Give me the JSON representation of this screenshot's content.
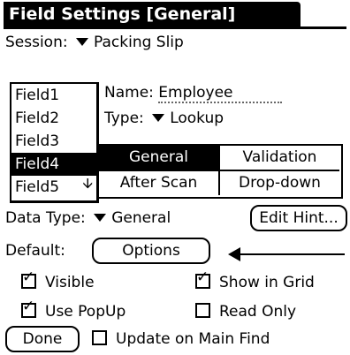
{
  "title": "Field Settings [General]",
  "session": {
    "label": "Session:",
    "value": "Packing Slip"
  },
  "fields": {
    "items": [
      "Field1",
      "Field2",
      "Field3",
      "Field4",
      "Field5"
    ],
    "selected": "Field4",
    "scroll_icon": "arrow-down-icon"
  },
  "name_field": {
    "label": "Name:",
    "value": "Employee"
  },
  "type_field": {
    "label": "Type:",
    "value": "Lookup"
  },
  "tabs": [
    {
      "label": "General",
      "active": true
    },
    {
      "label": "Validation",
      "active": false
    },
    {
      "label": "After Scan",
      "active": false
    },
    {
      "label": "Drop-down",
      "active": false
    }
  ],
  "data_type": {
    "label": "Data Type:",
    "value": "General"
  },
  "edit_hint_button": "Edit Hint...",
  "default": {
    "label": "Default:",
    "button": "Options"
  },
  "checkboxes": {
    "visible": {
      "label": "Visible",
      "checked": true
    },
    "show_in_grid": {
      "label": "Show in Grid",
      "checked": true
    },
    "use_popup": {
      "label": "Use PopUp",
      "checked": true
    },
    "read_only": {
      "label": "Read Only",
      "checked": false
    },
    "update_on_main_find": {
      "label": "Update on Main Find",
      "checked": false
    }
  },
  "done_button": "Done",
  "colors": {
    "foreground": "#000000",
    "background": "#ffffff"
  }
}
